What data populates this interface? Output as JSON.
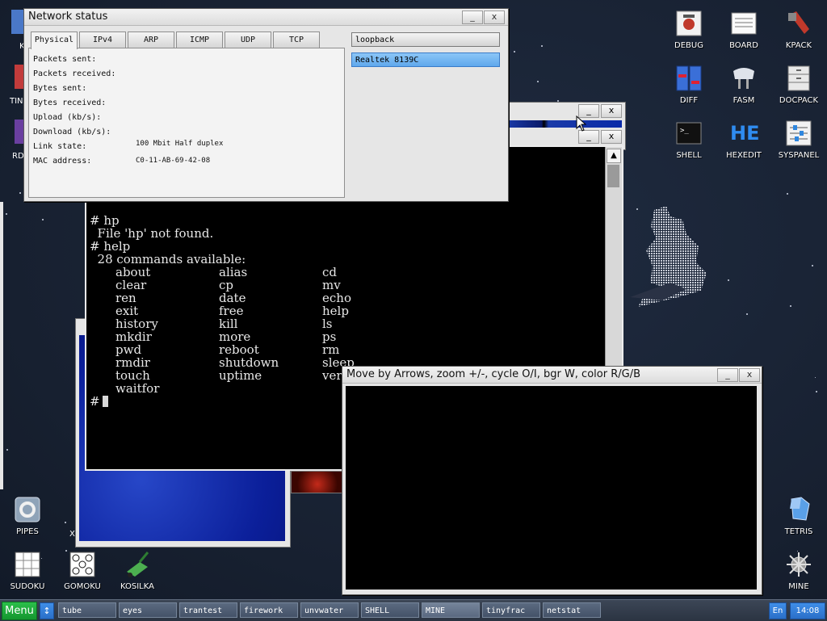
{
  "desktop": {
    "icons_right": [
      {
        "label": "DEBUG",
        "icon": "debug-icon"
      },
      {
        "label": "BOARD",
        "icon": "board-icon"
      },
      {
        "label": "KPACK",
        "icon": "kpack-icon"
      },
      {
        "label": "DIFF",
        "icon": "diff-icon"
      },
      {
        "label": "FASM",
        "icon": "fasm-icon"
      },
      {
        "label": "DOCPACK",
        "icon": "docpack-icon"
      },
      {
        "label": "SHELL",
        "icon": "shell-icon"
      },
      {
        "label": "HEXEDIT",
        "icon": "hexedit-icon"
      },
      {
        "label": "SYSPANEL",
        "icon": "syspanel-icon"
      }
    ],
    "icons_left": [
      {
        "label": "PIPES",
        "icon": "pipes-icon"
      },
      {
        "label": "SUDOKU",
        "icon": "sudoku-icon"
      },
      {
        "label": "GOMOKU",
        "icon": "gomoku-icon"
      },
      {
        "label": "KOSILKA",
        "icon": "kosilka-icon"
      },
      {
        "label": "TETRIS",
        "icon": "tetris-icon"
      },
      {
        "label": "MINE",
        "icon": "mine-icon"
      }
    ],
    "partial_labels": [
      "K",
      "TIN",
      "RDS",
      "X"
    ],
    "hexedit_glyph": "HE"
  },
  "network": {
    "title": "Network status",
    "tabs": [
      "Physical",
      "IPv4",
      "ARP",
      "ICMP",
      "UDP",
      "TCP"
    ],
    "fields": [
      {
        "label": "Packets sent:",
        "value": ""
      },
      {
        "label": "Packets received:",
        "value": ""
      },
      {
        "label": "Bytes sent:",
        "value": ""
      },
      {
        "label": "Bytes received:",
        "value": ""
      },
      {
        "label": "Upload (kb/s):",
        "value": ""
      },
      {
        "label": "Download (kb/s):",
        "value": ""
      },
      {
        "label": "Link state:",
        "value": "100 Mbit Half duplex"
      },
      {
        "label": "MAC address:",
        "value": "C0-11-AB-69-42-08"
      }
    ],
    "interfaces": [
      "loopback",
      "Realtek 8139C"
    ]
  },
  "shell": {
    "lines": [
      "# hp",
      "  File 'hp' not found.",
      "# help",
      "  28 commands available:"
    ],
    "commands": [
      [
        "about",
        "alias",
        "cd"
      ],
      [
        "clear",
        "cp",
        "mv"
      ],
      [
        "ren",
        "date",
        "echo"
      ],
      [
        "exit",
        "free",
        "help"
      ],
      [
        "history",
        "kill",
        "ls"
      ],
      [
        "mkdir",
        "more",
        "ps"
      ],
      [
        "pwd",
        "reboot",
        "rm"
      ],
      [
        "rmdir",
        "shutdown",
        "sleep"
      ],
      [
        "touch",
        "uptime",
        "ver"
      ],
      [
        "waitfor",
        "",
        ""
      ]
    ],
    "prompt": "#"
  },
  "viewer": {
    "title": "Move by Arrows, zoom +/-, cycle O/I, bgr W, color R/G/B"
  },
  "window_buttons": {
    "minimize": "_",
    "close": "x"
  },
  "taskbar": {
    "menu_label": "Menu",
    "up_glyph": "↕",
    "tasks": [
      "tube",
      "eyes",
      "trantest",
      "firework",
      "unvwater",
      "SHELL",
      "MINE",
      "tinyfrac",
      "netstat"
    ],
    "lang": "En",
    "clock": "14:08"
  }
}
